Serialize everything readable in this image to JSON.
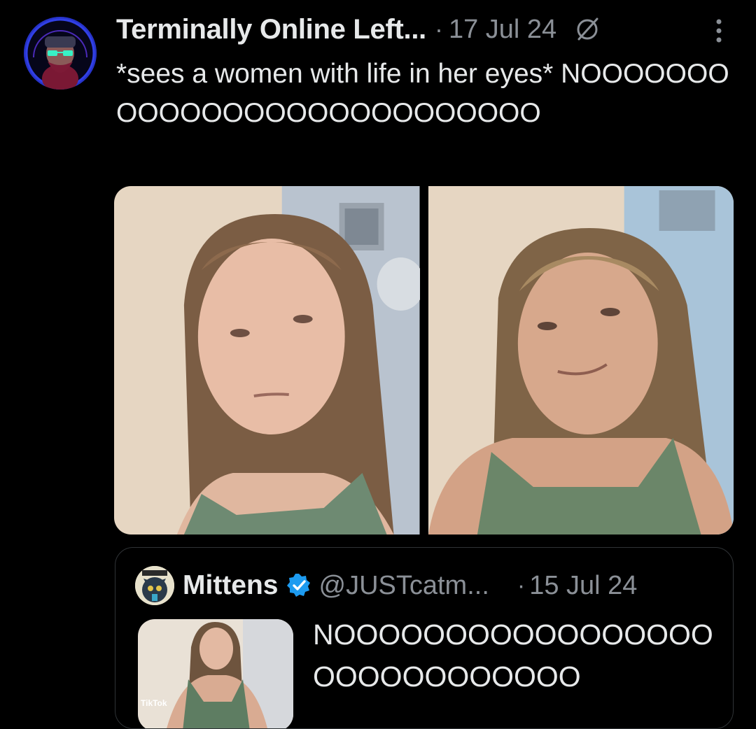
{
  "tweet": {
    "display_name": "Terminally Online Left...",
    "separator": "·",
    "date": "17 Jul 24",
    "text": "*sees a women with life in her eyes* NOOOOOOOOOOOOOOOOOOOOOOOOOOO",
    "icons": {
      "grok": "grok-slash-icon",
      "more": "more-vertical-icon"
    },
    "media": [
      "photo-1",
      "photo-2"
    ]
  },
  "quote": {
    "display_name": "Mittens",
    "verified_icon": "verified-badge-icon",
    "handle": "@JUSTcatm...",
    "separator": "·",
    "date": "15 Jul 24",
    "text": "NOOOOOOOOOOOOOOOOOOOOOOOOOOOOO",
    "thumbnail_watermark": "TikTok"
  },
  "colors": {
    "background": "#000000",
    "text_primary": "#e7e9ea",
    "text_secondary": "#8b9097",
    "border": "#2f3336",
    "verified": "#1d9bf0"
  }
}
